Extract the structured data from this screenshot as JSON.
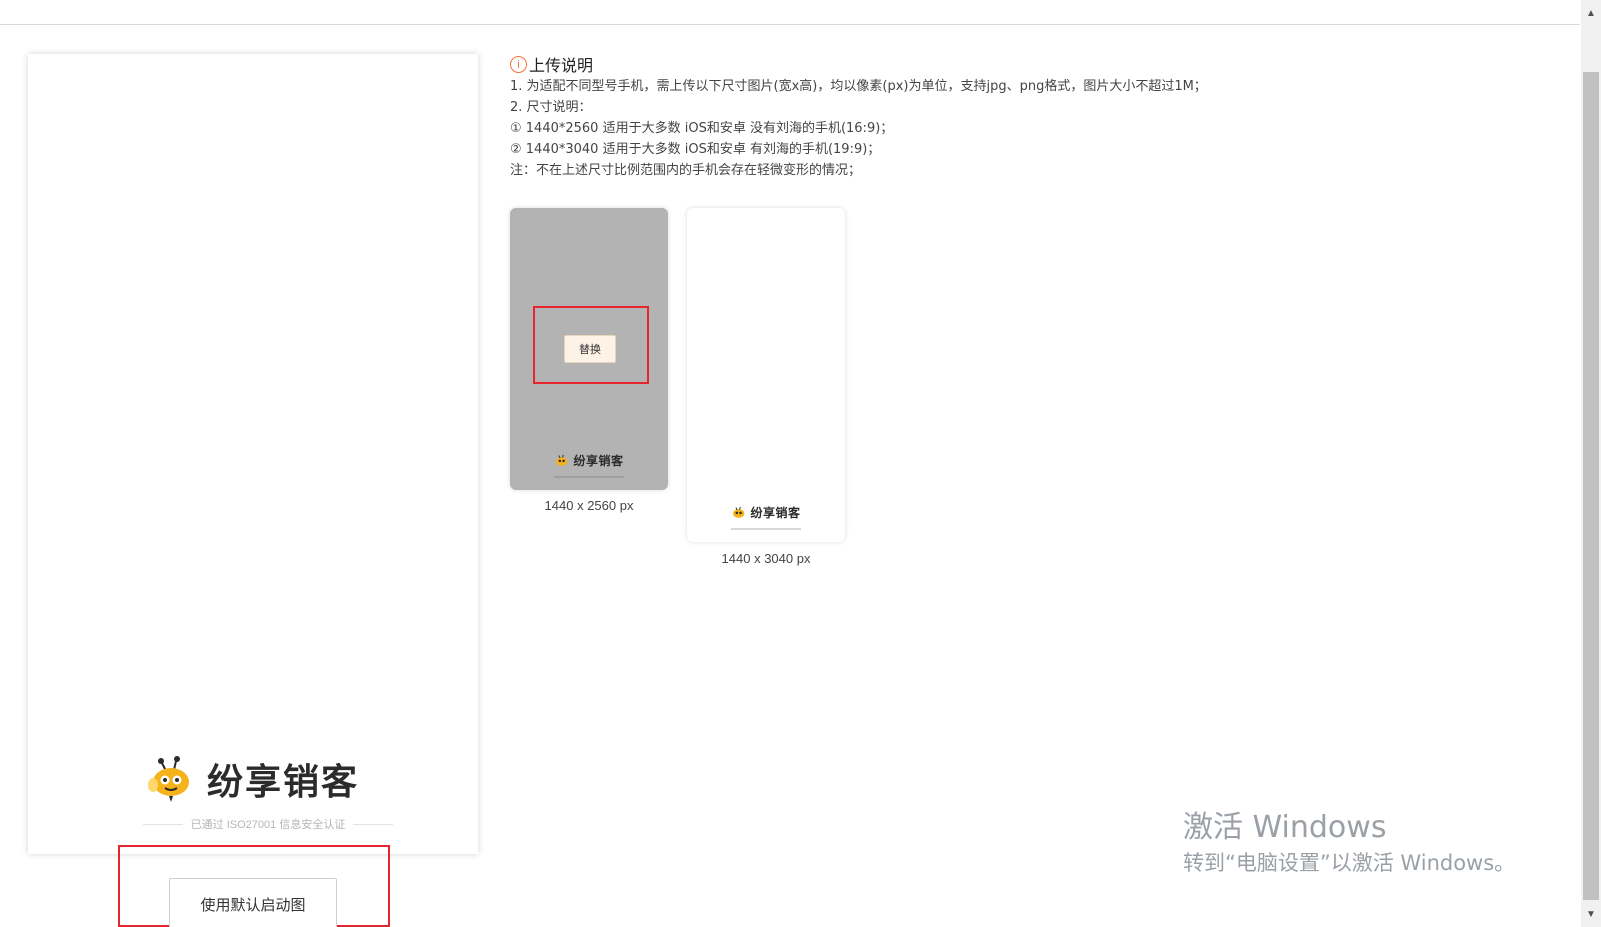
{
  "brand": {
    "name": "纷享销客",
    "certification": "已通过 ISO27001 信息安全认证"
  },
  "preview": {
    "default_button_label": "使用默认启动图"
  },
  "upload_info": {
    "icon": "info-circle-icon",
    "title": "上传说明",
    "lines": [
      "1. 为适配不同型号手机，需上传以下尺寸图片(宽x高)，均以像素(px)为单位，支持jpg、png格式，图片大小不超过1M；",
      "2. 尺寸说明：",
      "① 1440*2560 适用于大多数 iOS和安卓 没有刘海的手机(16:9)；",
      "② 1440*3040 适用于大多数 iOS和安卓 有刘海的手机(19:9)；",
      "注：不在上述尺寸比例范围内的手机会存在轻微变形的情况；"
    ]
  },
  "thumbnails": [
    {
      "caption": "1440 x 2560 px",
      "replace_label": "替换"
    },
    {
      "caption": "1440 x 3040 px"
    }
  ],
  "watermark": {
    "line1": "激活 Windows",
    "line2": "转到“电脑设置”以激活 Windows。"
  },
  "colors": {
    "highlight_red": "#e6262d",
    "info_orange": "#f2733b",
    "thumb_gray": "#b3b3b3",
    "bee_yellow": "#f5b21b"
  }
}
